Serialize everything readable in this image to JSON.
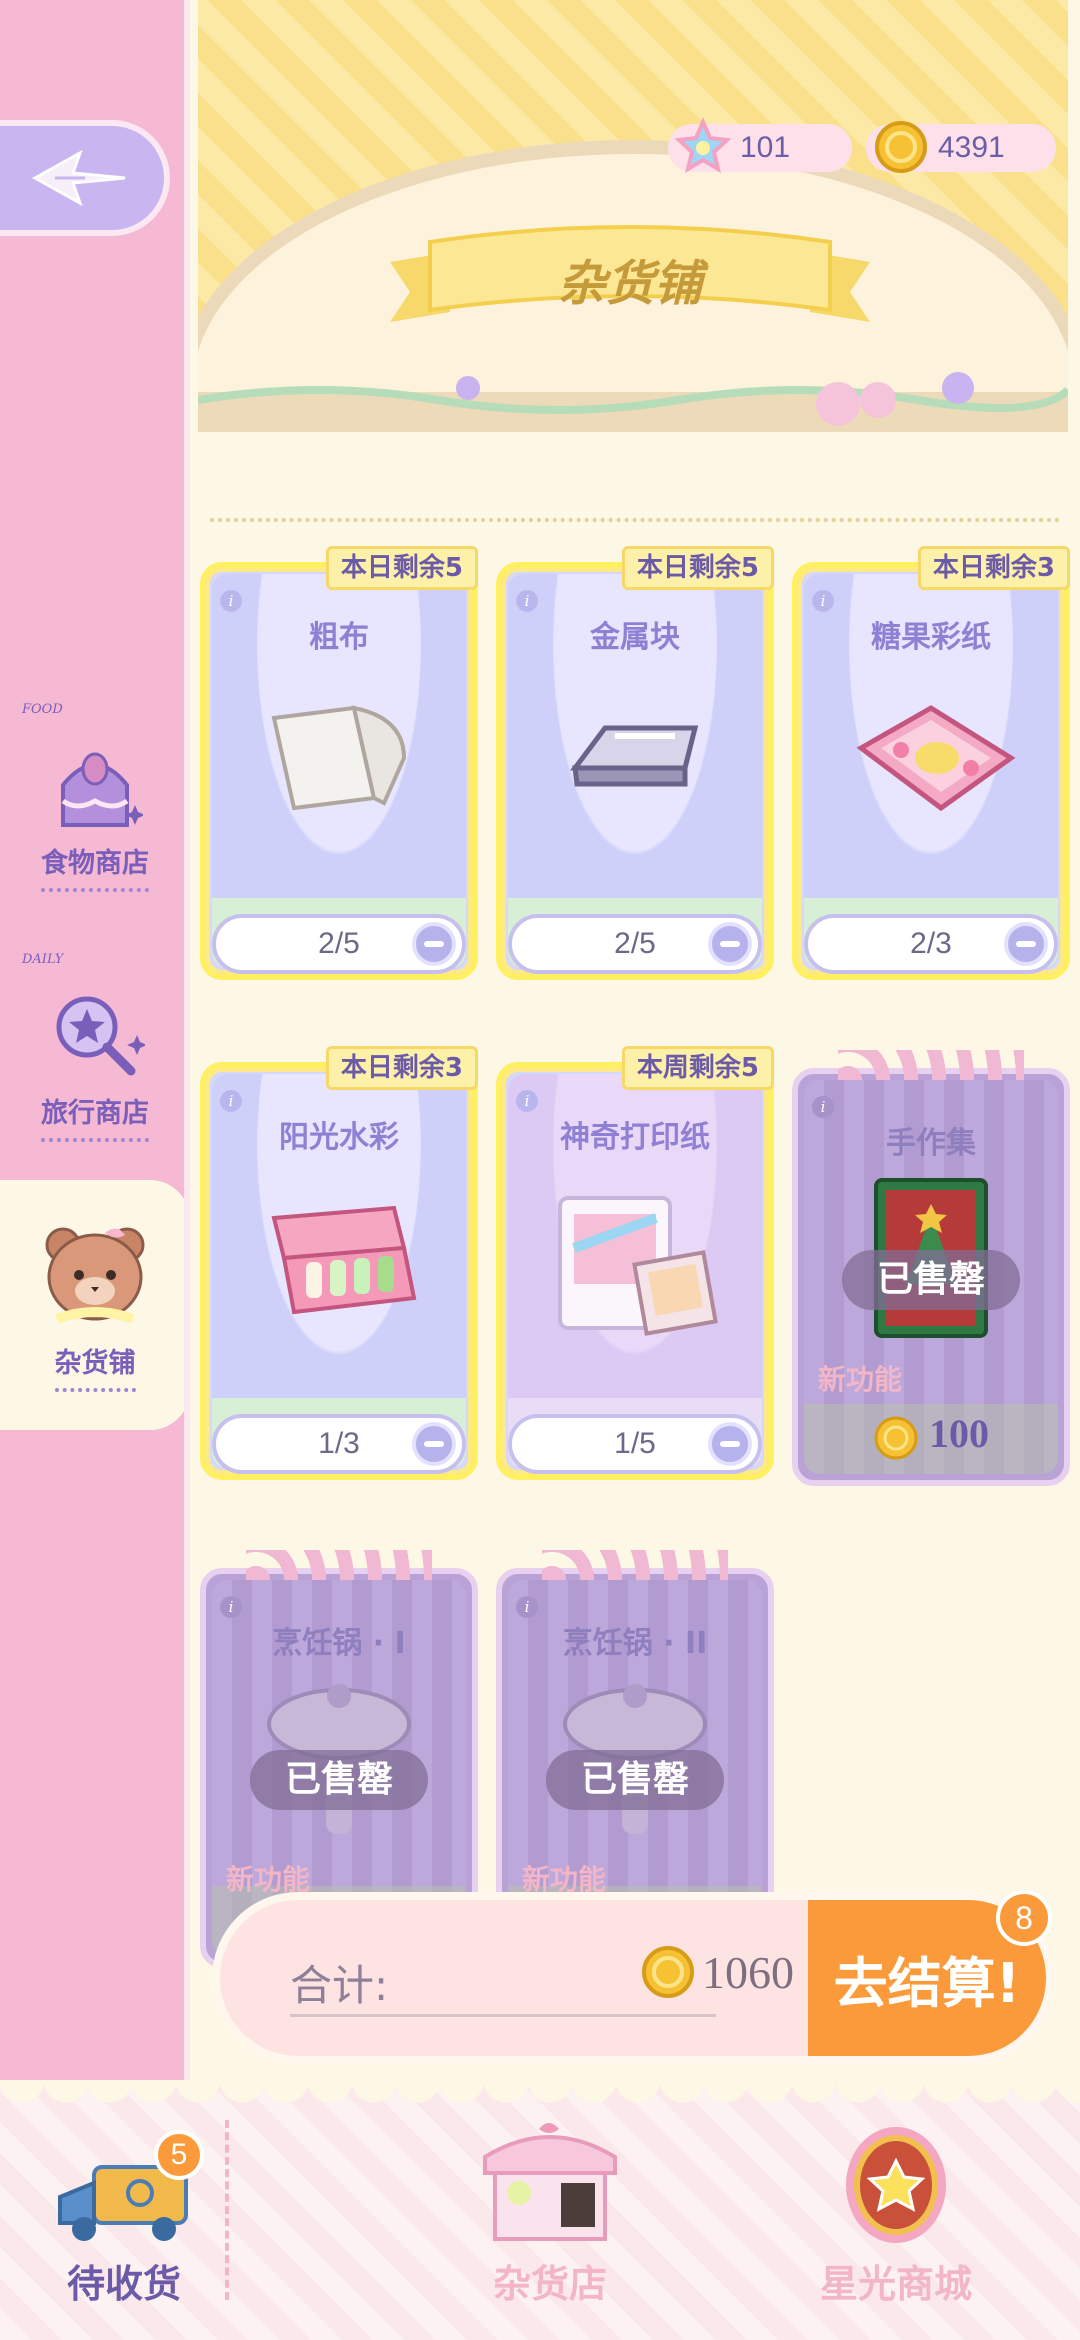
{
  "currencies": [
    {
      "icon": "rainbow-star-icon",
      "value": "101"
    },
    {
      "icon": "gold-coin-icon",
      "value": "4391"
    }
  ],
  "shop_title": "杂货铺",
  "sidebar": {
    "items": [
      {
        "tag": "FOOD",
        "label": "食物商店",
        "icon": "cake-icon"
      },
      {
        "tag": "DAILY",
        "label": "旅行商店",
        "icon": "magnifier-star-icon"
      },
      {
        "tag": "",
        "label": "杂货铺",
        "icon": "bear-icon"
      }
    ]
  },
  "cards": [
    {
      "name": "粗布",
      "badge": "本日剩余5",
      "qty": "2/5",
      "state": "active"
    },
    {
      "name": "金属块",
      "badge": "本日剩余5",
      "qty": "2/5",
      "state": "active"
    },
    {
      "name": "糖果彩纸",
      "badge": "本日剩余3",
      "qty": "2/3",
      "state": "active"
    },
    {
      "name": "阳光水彩",
      "badge": "本日剩余3",
      "qty": "1/3",
      "state": "active"
    },
    {
      "name": "神奇打印纸",
      "badge": "本周剩余5",
      "qty": "1/5",
      "state": "active"
    },
    {
      "name": "手作集",
      "sold": "已售罄",
      "new": "新功能",
      "price": "100",
      "state": "sold"
    },
    {
      "name": "烹饪锅 · I",
      "sold": "已售罄",
      "new": "新功能",
      "state": "sold"
    },
    {
      "name": "烹饪锅 · II",
      "sold": "已售罄",
      "new": "新功能",
      "state": "sold"
    }
  ],
  "checkout": {
    "label": "合计:",
    "amount": "1060",
    "button": "去结算!",
    "count": "8"
  },
  "tabs": [
    {
      "label": "待收货",
      "badge": "5",
      "icon": "delivery-truck-icon"
    },
    {
      "label": "杂货店",
      "icon": "shop-stall-icon"
    },
    {
      "label": "星光商城",
      "icon": "star-egg-icon"
    }
  ],
  "colors": {
    "accent_orange": "#fb9a3a",
    "sidebar_pink": "#f6b9d3",
    "text_purple": "#6a5aa8",
    "card_blue": "#d5d7fb",
    "badge_yellow": "#fdf0a8"
  }
}
